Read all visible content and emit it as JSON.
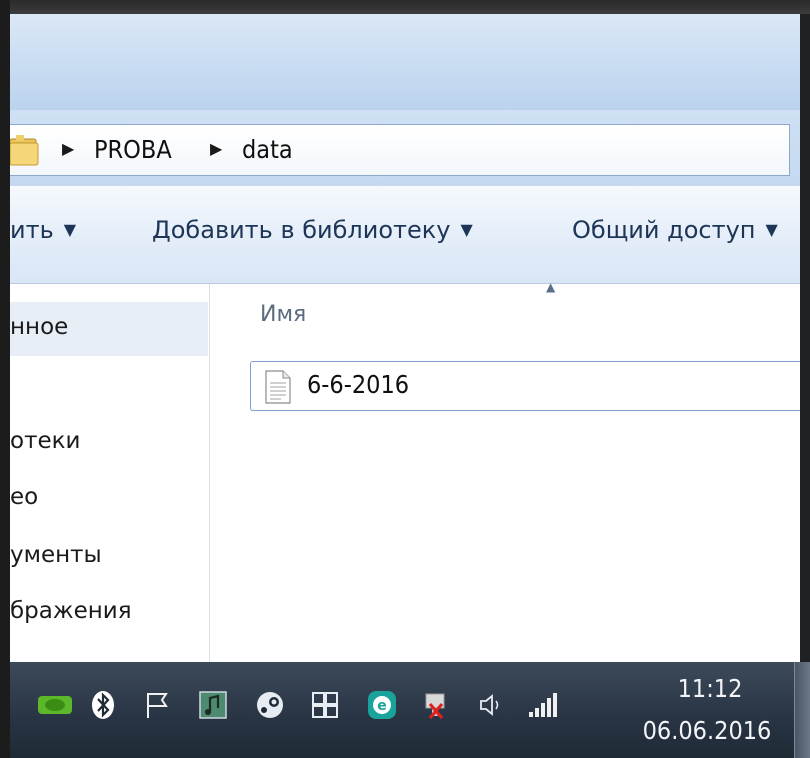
{
  "address": {
    "crumbs": [
      "PROBA",
      "data"
    ]
  },
  "toolbar": {
    "organize_label": "ить",
    "add_library_label": "Добавить в библиотеку",
    "share_label": "Общий доступ"
  },
  "nav": {
    "items": [
      {
        "label": "нное"
      },
      {
        "label": "отеки"
      },
      {
        "label": "ео"
      },
      {
        "label": "ументы"
      },
      {
        "label": "бражения"
      }
    ]
  },
  "content": {
    "column_name": "Имя",
    "files": [
      {
        "name": "6-6-2016",
        "icon": "text-file-icon"
      }
    ]
  },
  "tray": {
    "icons": [
      "nvidia-icon",
      "bluetooth-icon",
      "action-center-flag-icon",
      "music-app-icon",
      "steam-icon",
      "windows-grid-icon",
      "eset-icon",
      "power-disconnected-icon",
      "volume-icon",
      "network-signal-icon"
    ],
    "time": "11:12",
    "date": "06.06.2016"
  },
  "colors": {
    "titlebar": "#c8dcf2",
    "taskbar": "#283443",
    "selection_border": "#7da2ce"
  }
}
